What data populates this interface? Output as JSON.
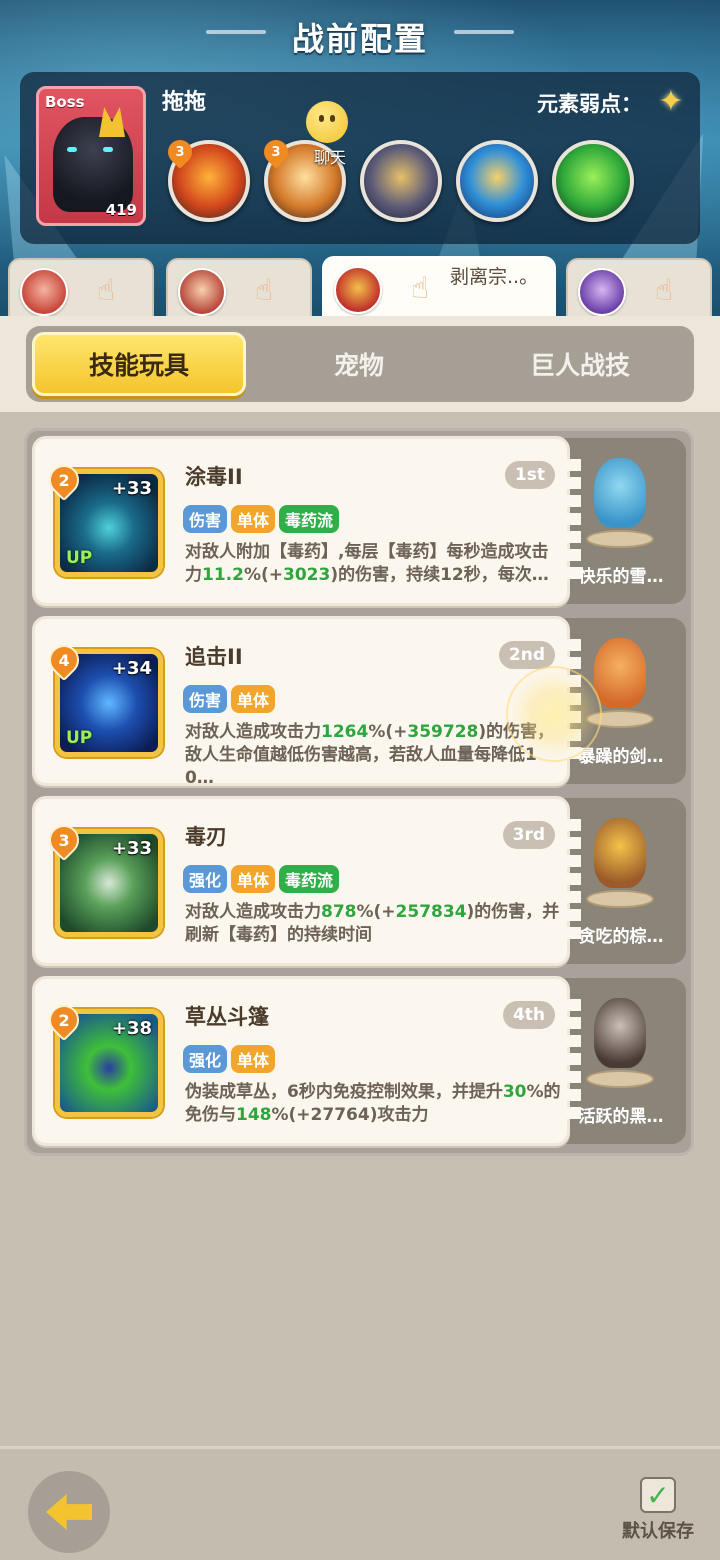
{
  "header": {
    "title": "战前配置"
  },
  "boss": {
    "tag": "Boss",
    "level": "419",
    "name": "拖拖",
    "weakness_label": "元素弱点：",
    "weakness_icon": "star-burst-icon"
  },
  "boss_skills": [
    {
      "level": "3",
      "icon": "fire-demon-skill-icon"
    },
    {
      "level": "3",
      "icon": "lightning-skill-icon"
    },
    {
      "icon": "golden-helmet-skill-icon"
    },
    {
      "icon": "hourglass-skill-icon"
    },
    {
      "icon": "green-slime-skill-icon"
    }
  ],
  "chat": {
    "label": "聊天"
  },
  "hero_tabs": [
    {
      "label": ""
    },
    {
      "label": ""
    },
    {
      "label": "剥离宗..。"
    },
    {
      "label": ""
    }
  ],
  "category_tabs": [
    {
      "label": "技能玩具",
      "active": true
    },
    {
      "label": "宠物",
      "active": false
    },
    {
      "label": "巨人战技",
      "active": false
    }
  ],
  "skills": [
    {
      "name": "涂毒II",
      "rank": "1st",
      "level": "2",
      "plus": "+33",
      "up": "UP",
      "tags": [
        "伤害",
        "单体",
        "毒药流"
      ],
      "desc_a": "对敌人附加【毒药】,每层【毒药】每秒造成攻击力",
      "desc_hl1": "11.2",
      "desc_b": "%(+",
      "desc_hl2": "3023",
      "desc_c": ")的伤害，持续12秒，每次…",
      "pet_name": "快乐的雪…"
    },
    {
      "name": "追击II",
      "rank": "2nd",
      "level": "4",
      "plus": "+34",
      "up": "UP",
      "tags": [
        "伤害",
        "单体"
      ],
      "desc_a": "对敌人造成攻击力",
      "desc_hl1": "1264",
      "desc_b": "%(+",
      "desc_hl2": "359728",
      "desc_c": ")的伤害，敌人生命值越低伤害越高，若敌人血量每降低10…",
      "pet_name": "暴躁的剑…"
    },
    {
      "name": "毒刃",
      "rank": "3rd",
      "level": "3",
      "plus": "+33",
      "up": "",
      "tags": [
        "强化",
        "单体",
        "毒药流"
      ],
      "desc_a": "对敌人造成攻击力",
      "desc_hl1": "878",
      "desc_b": "%(+",
      "desc_hl2": "257834",
      "desc_c": ")的伤害，并刷新【毒药】的持续时间",
      "pet_name": "贪吃的棕…"
    },
    {
      "name": "草丛斗篷",
      "rank": "4th",
      "level": "2",
      "plus": "+38",
      "up": "",
      "tags": [
        "强化",
        "单体"
      ],
      "desc_a": "伪装成草丛，6秒内免疫控制效果，并提升",
      "desc_hl1": "30",
      "desc_b": "%的免伤与",
      "desc_hl2": "148",
      "desc_c": "%(+27764)攻击力",
      "pet_name": "活跃的黑…"
    }
  ],
  "footer": {
    "save_label": "默认保存"
  }
}
